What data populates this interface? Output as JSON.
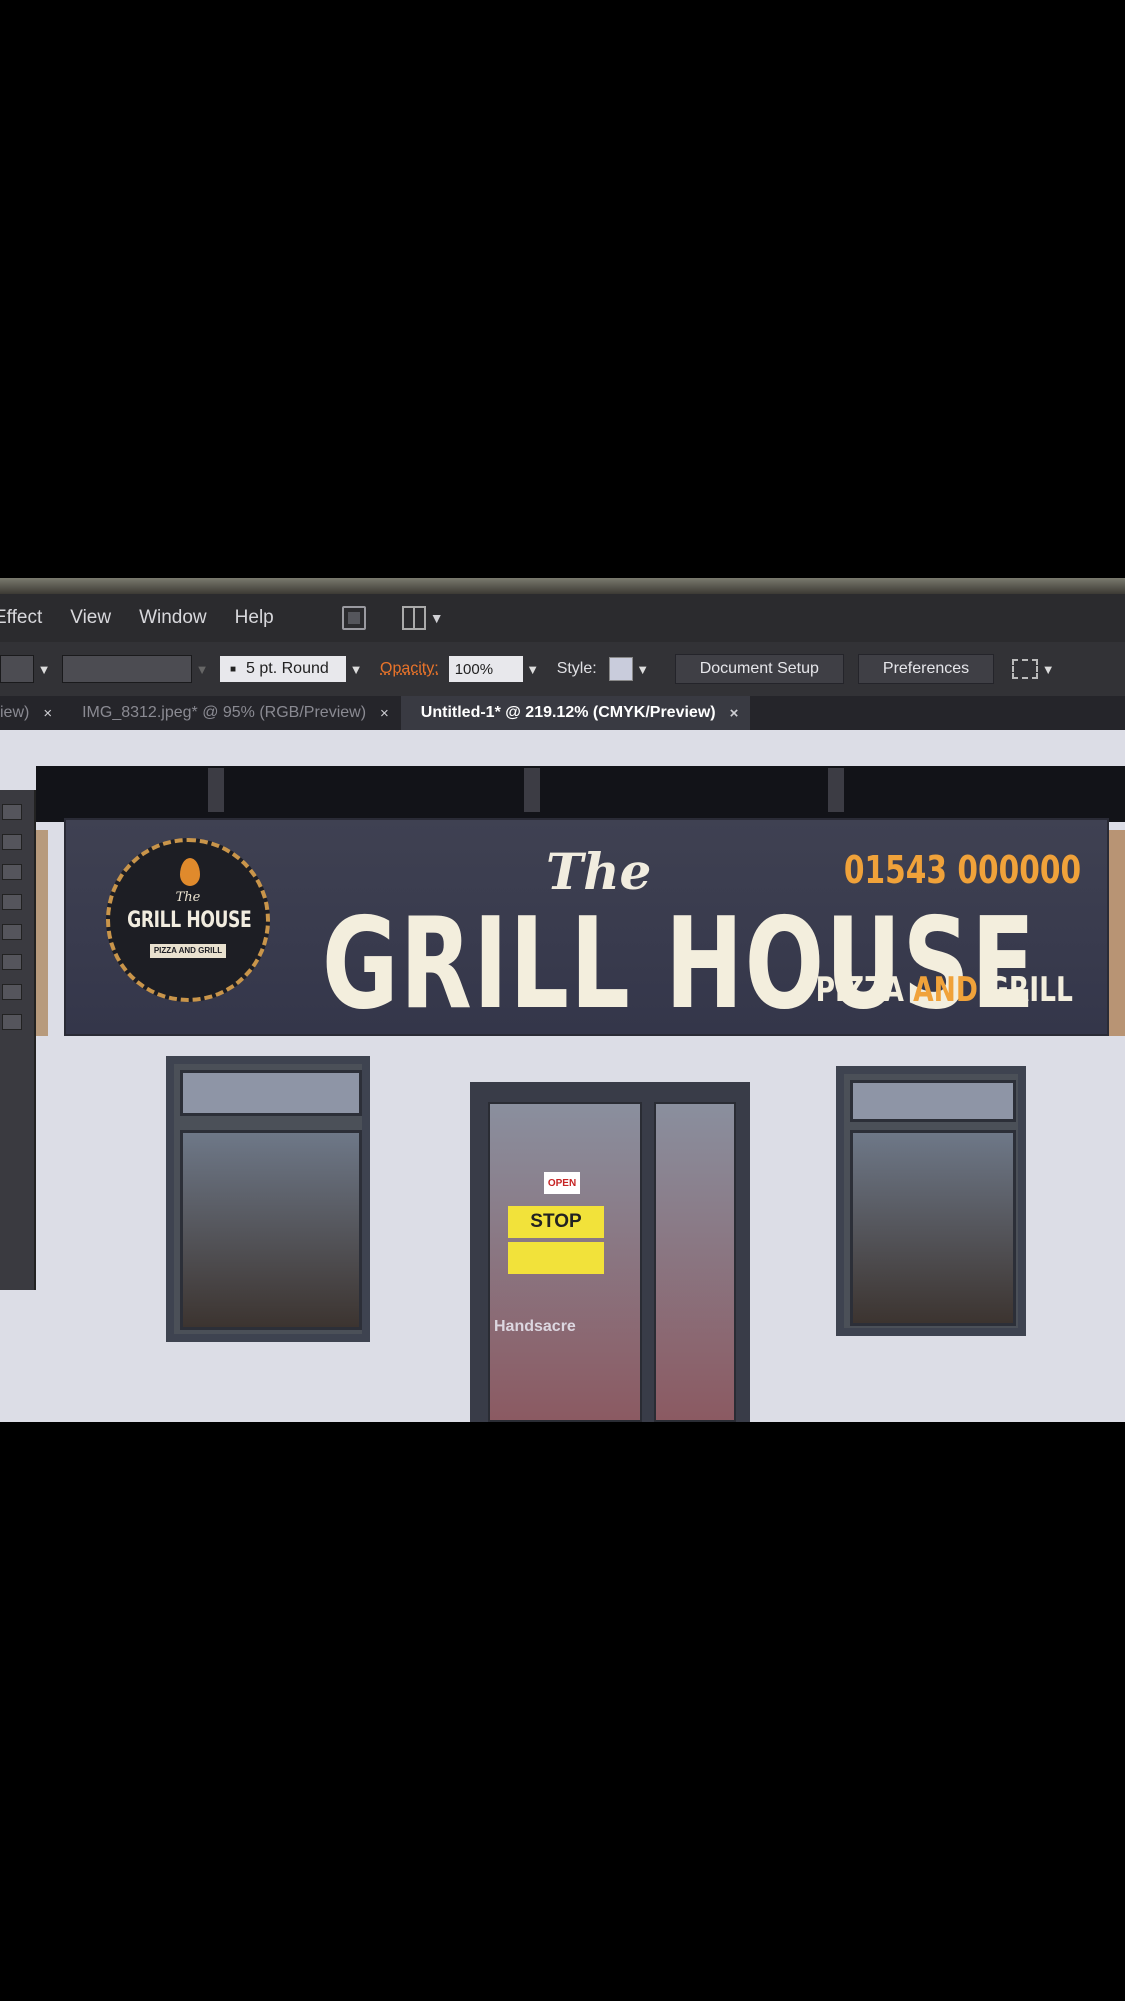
{
  "menu": {
    "items": [
      "Effect",
      "View",
      "Window",
      "Help"
    ]
  },
  "controlbar": {
    "stroke_profile": "5 pt. Round",
    "opacity_label": "Opacity:",
    "opacity_value": "100%",
    "style_label": "Style:",
    "document_setup": "Document Setup",
    "preferences": "Preferences"
  },
  "tabs": [
    {
      "label": "iew)",
      "active": false
    },
    {
      "label": "IMG_8312.jpeg* @ 95% (RGB/Preview)",
      "active": false
    },
    {
      "label": "Untitled-1* @ 219.12% (CMYK/Preview)",
      "active": true
    }
  ],
  "tab_close": "×",
  "artwork": {
    "logo": {
      "the": "The",
      "name": "GRILL HOUSE",
      "sub": "PIZZA AND GRILL"
    },
    "sign_the": "The",
    "sign_name": "GRILL HOUSE",
    "phone": "01543 000000",
    "tagline_a": "PIZZA",
    "tagline_b": "AND",
    "tagline_c": "GRILL",
    "door_open": "OPEN",
    "door_stop": "STOP",
    "door_text": "Handsacre"
  },
  "colors": {
    "sign_bg": "#3f4152",
    "accent": "#f0a23a",
    "ui_dark": "#2b2b2e"
  }
}
